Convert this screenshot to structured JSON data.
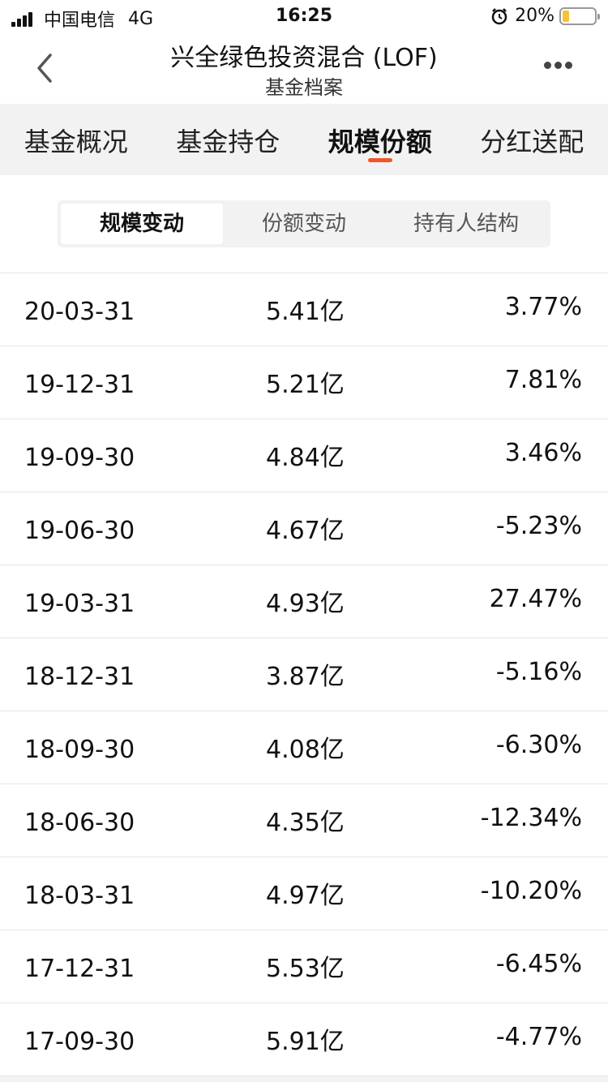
{
  "status_bar": {
    "carrier": "中国电信",
    "network": "4G",
    "time": "16:25",
    "battery_percent_label": "20%",
    "battery_level": 0.2
  },
  "nav": {
    "title": "兴全绿色投资混合 (LOF)",
    "subtitle": "基金档案"
  },
  "tabs": [
    {
      "label": "基金概况",
      "active": false
    },
    {
      "label": "基金持仓",
      "active": false
    },
    {
      "label": "规模份额",
      "active": true
    },
    {
      "label": "分红送配",
      "active": false
    }
  ],
  "segments": [
    {
      "label": "规模变动",
      "active": true
    },
    {
      "label": "份额变动",
      "active": false
    },
    {
      "label": "持有人结构",
      "active": false
    }
  ],
  "rows": [
    {
      "date": "20-03-31",
      "scale": "5.41亿",
      "change": "3.77%"
    },
    {
      "date": "19-12-31",
      "scale": "5.21亿",
      "change": "7.81%"
    },
    {
      "date": "19-09-30",
      "scale": "4.84亿",
      "change": "3.46%"
    },
    {
      "date": "19-06-30",
      "scale": "4.67亿",
      "change": "-5.23%"
    },
    {
      "date": "19-03-31",
      "scale": "4.93亿",
      "change": "27.47%"
    },
    {
      "date": "18-12-31",
      "scale": "3.87亿",
      "change": "-5.16%"
    },
    {
      "date": "18-09-30",
      "scale": "4.08亿",
      "change": "-6.30%"
    },
    {
      "date": "18-06-30",
      "scale": "4.35亿",
      "change": "-12.34%"
    },
    {
      "date": "18-03-31",
      "scale": "4.97亿",
      "change": "-10.20%"
    },
    {
      "date": "17-12-31",
      "scale": "5.53亿",
      "change": "-6.45%"
    },
    {
      "date": "17-09-30",
      "scale": "5.91亿",
      "change": "-4.77%"
    }
  ],
  "colors": {
    "accent": "#f2552c",
    "battery": "#f3c433"
  }
}
